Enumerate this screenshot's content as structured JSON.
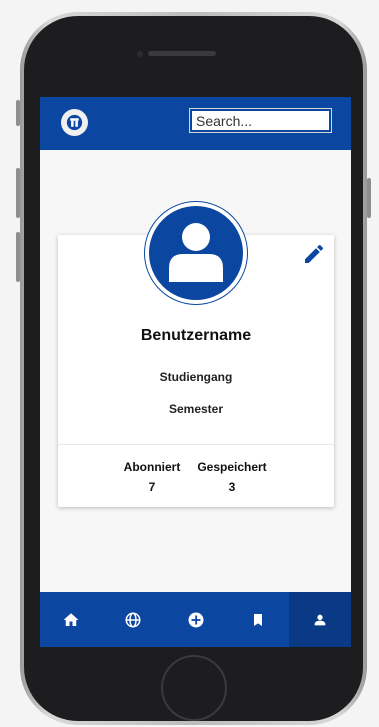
{
  "header": {
    "search_placeholder": "Search..."
  },
  "profile": {
    "username": "Benutzername",
    "studiengang": "Studiengang",
    "semester": "Semester",
    "stats": [
      {
        "label": "Abonniert",
        "value": "7"
      },
      {
        "label": "Gespeichert",
        "value": "3"
      }
    ]
  },
  "bottom_nav": {
    "items": [
      {
        "icon": "home-icon"
      },
      {
        "icon": "globe-icon"
      },
      {
        "icon": "add-circle-icon"
      },
      {
        "icon": "bookmark-icon"
      },
      {
        "icon": "person-icon",
        "active": true
      }
    ]
  },
  "colors": {
    "primary": "#0b47a1",
    "nav_active": "#0a3a85",
    "background": "#f7f7f7"
  }
}
